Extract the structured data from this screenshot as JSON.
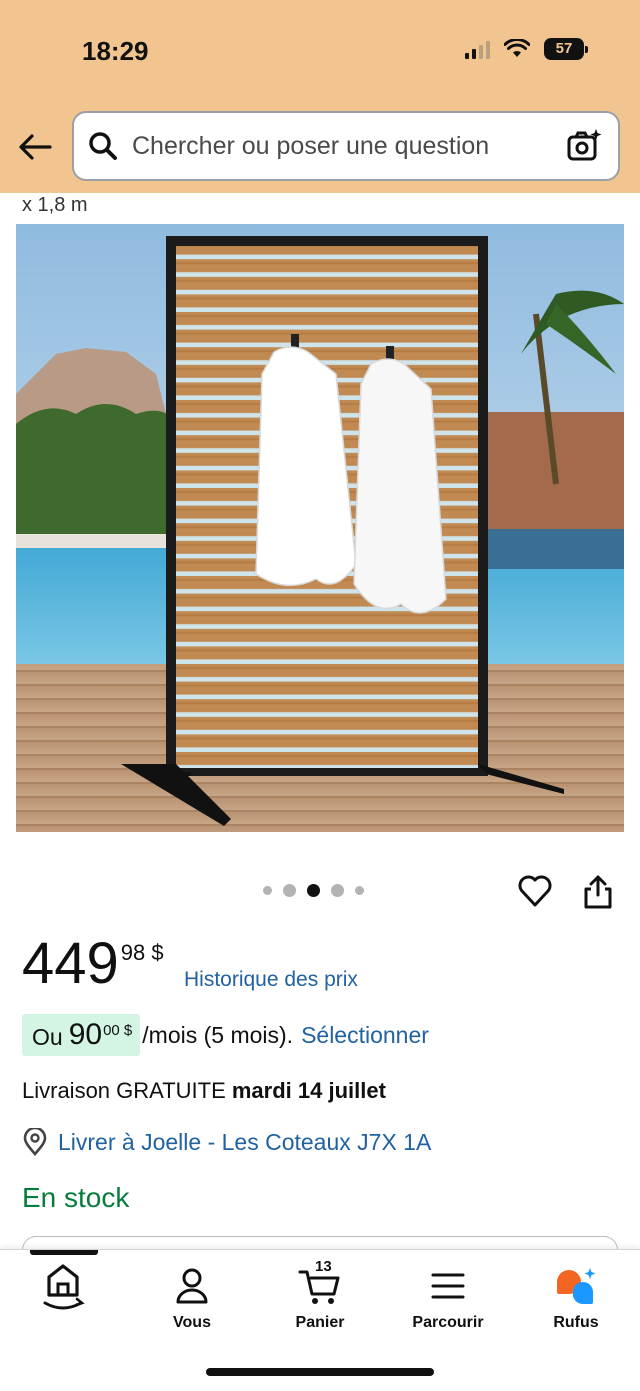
{
  "status_bar": {
    "time": "18:29",
    "battery": "57"
  },
  "header": {
    "search_placeholder": "Chercher ou poser une question",
    "colors": {
      "header_bg": "#f2c590"
    }
  },
  "product": {
    "dimension_fragment": "x 1,8 m",
    "image": {
      "alt": "Écran d'intimité en bois avec serviettes blanches, piscine en arrière-plan",
      "total_images": 5,
      "active_index": 2
    },
    "price": {
      "whole": "449",
      "fraction": "98 $",
      "history_link": "Historique des prix"
    },
    "installment": {
      "prefix": "Ou",
      "amount_whole": "90",
      "amount_fraction": "00 $",
      "suffix": "/mois (5 mois).",
      "select_link": "Sélectionner"
    },
    "delivery": {
      "prefix": "Livraison GRATUITE",
      "date": "mardi 14 juillet"
    },
    "location": "Livrer à Joelle - Les Coteaux J7X 1A",
    "stock": "En stock",
    "colors": {
      "link": "#2162a1",
      "stock": "#067d3c",
      "installment_bg": "#d4f5e4"
    }
  },
  "tabbar": {
    "tabs": [
      {
        "label": "",
        "icon": "home-icon"
      },
      {
        "label": "Vous",
        "icon": "user-icon"
      },
      {
        "label": "Panier",
        "icon": "cart-icon",
        "badge": "13"
      },
      {
        "label": "Parcourir",
        "icon": "menu-icon"
      },
      {
        "label": "Rufus",
        "icon": "rufus-icon"
      }
    ]
  }
}
